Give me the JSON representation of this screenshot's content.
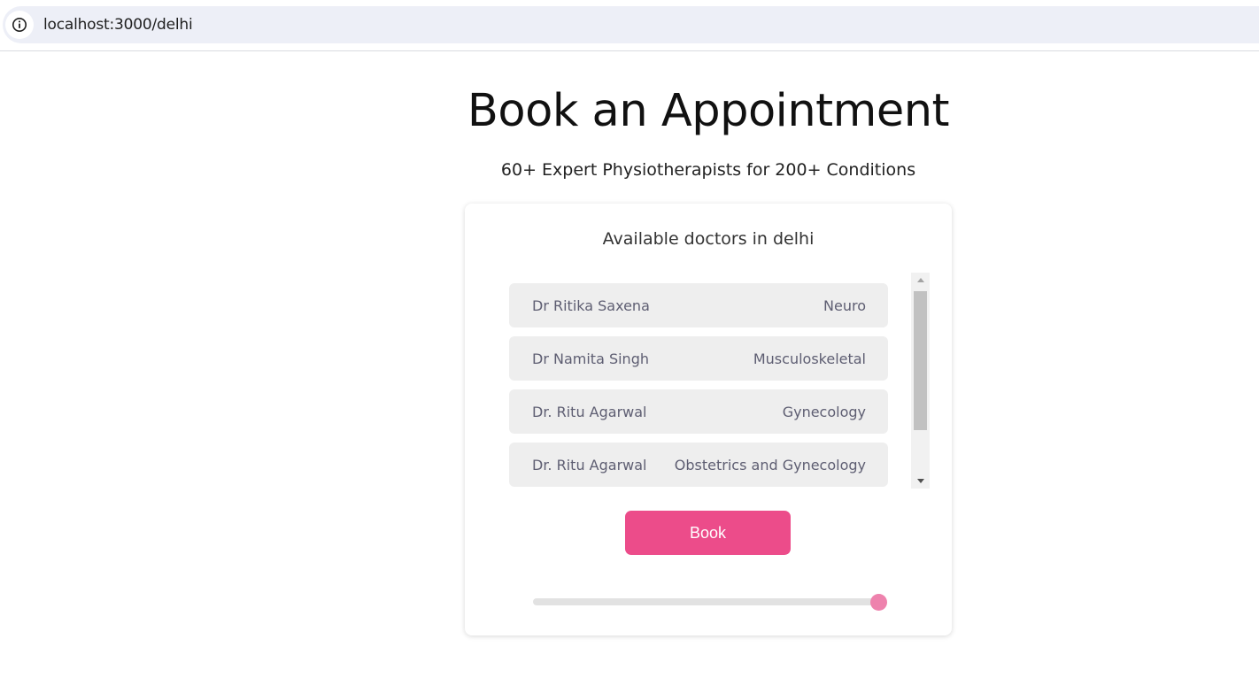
{
  "browser": {
    "url": "localhost:3000/delhi"
  },
  "page": {
    "title": "Book an Appointment",
    "subtitle": "60+ Expert Physiotherapists for 200+ Conditions"
  },
  "card": {
    "heading": "Available doctors in delhi",
    "doctors": [
      {
        "name": "Dr Ritika Saxena",
        "specialty": "Neuro"
      },
      {
        "name": "Dr Namita Singh",
        "specialty": "Musculoskeletal"
      },
      {
        "name": "Dr. Ritu Agarwal",
        "specialty": "Gynecology"
      },
      {
        "name": "Dr. Ritu Agarwal",
        "specialty": "Obstetrics and Gynecology"
      }
    ],
    "book_label": "Book",
    "slider_value_fraction": 1.0
  },
  "colors": {
    "accent": "#ec4c8a",
    "slider_thumb": "#ee82ad",
    "row_background": "#eeeeee",
    "address_bar": "#edeff7"
  },
  "icons": {
    "site_info": "info-circle-icon"
  }
}
